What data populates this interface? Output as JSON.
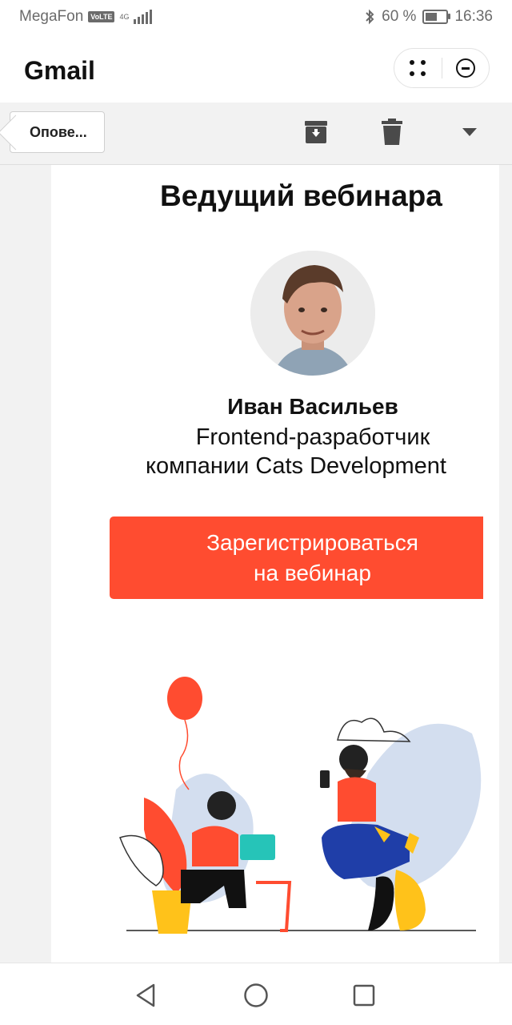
{
  "status_bar": {
    "carrier": "MegaFon",
    "volte": "VoLTE",
    "network": "4G",
    "battery_percent": "60 %",
    "battery_level": 0.6,
    "time": "16:36"
  },
  "app_bar": {
    "title": "Gmail"
  },
  "toolbar": {
    "back_label": "Опове..."
  },
  "email": {
    "heading": "Ведущий вебинара",
    "speaker_name": "Иван Васильев",
    "speaker_role_line1": "Frontend-разработчик",
    "speaker_role_line2": "компании Cats Development",
    "register_line1": "Зарегистрироваться",
    "register_line2": "на вебинар"
  },
  "colors": {
    "accent": "#ff4c30",
    "background": "#f2f2f2",
    "text": "#111111"
  },
  "icons": {
    "archive": "archive-icon",
    "delete": "trash-icon",
    "more": "chevron-down-icon",
    "menu": "grid-dots-icon",
    "close": "minus-circle-icon",
    "back": "nav-back-icon",
    "home": "nav-home-icon",
    "recent": "nav-recent-icon"
  }
}
